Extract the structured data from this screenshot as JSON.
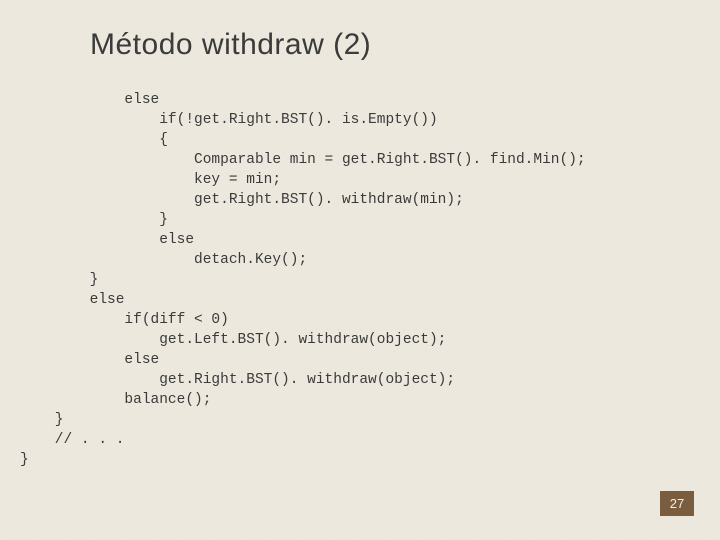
{
  "title": "Método withdraw (2)",
  "code_lines": [
    "            else",
    "                if(!get.Right.BST(). is.Empty())",
    "                {",
    "                    Comparable min = get.Right.BST(). find.Min();",
    "                    key = min;",
    "                    get.Right.BST(). withdraw(min);",
    "                }",
    "                else",
    "                    detach.Key();",
    "        }",
    "        else",
    "            if(diff < 0)",
    "                get.Left.BST(). withdraw(object);",
    "            else",
    "                get.Right.BST(). withdraw(object);",
    "            balance();",
    "    }",
    "    // . . .",
    "}"
  ],
  "page_number": "27"
}
